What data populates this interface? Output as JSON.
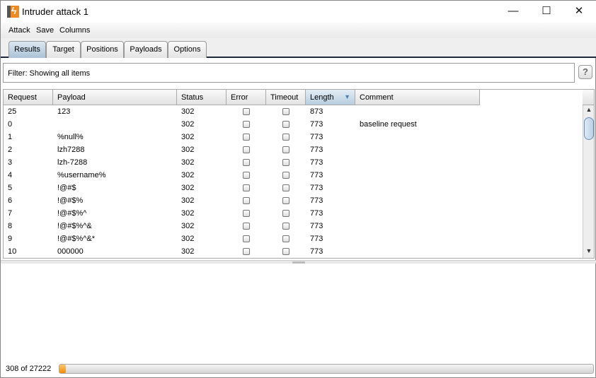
{
  "window": {
    "title": "Intruder attack 1",
    "minimize": "—",
    "maximize": "☐",
    "close": "✕"
  },
  "menu": [
    "Attack",
    "Save",
    "Columns"
  ],
  "tabs": [
    {
      "label": "Results",
      "active": true
    },
    {
      "label": "Target"
    },
    {
      "label": "Positions"
    },
    {
      "label": "Payloads"
    },
    {
      "label": "Options"
    }
  ],
  "filter": {
    "text": "Filter:  Showing all items",
    "help": "?"
  },
  "table": {
    "columns": [
      "Request",
      "Payload",
      "Status",
      "Error",
      "Timeout",
      "Length",
      "Comment"
    ],
    "sorted_column": "Length",
    "sort_direction": "descending",
    "rows": [
      {
        "request": "25",
        "payload": "123",
        "status": "302",
        "error": false,
        "timeout": false,
        "length": "873",
        "comment": ""
      },
      {
        "request": "0",
        "payload": "",
        "status": "302",
        "error": false,
        "timeout": false,
        "length": "773",
        "comment": "baseline request"
      },
      {
        "request": "1",
        "payload": "%null%",
        "status": "302",
        "error": false,
        "timeout": false,
        "length": "773",
        "comment": ""
      },
      {
        "request": "2",
        "payload": "lzh7288",
        "status": "302",
        "error": false,
        "timeout": false,
        "length": "773",
        "comment": ""
      },
      {
        "request": "3",
        "payload": "lzh-7288",
        "status": "302",
        "error": false,
        "timeout": false,
        "length": "773",
        "comment": ""
      },
      {
        "request": "4",
        "payload": "%username%",
        "status": "302",
        "error": false,
        "timeout": false,
        "length": "773",
        "comment": ""
      },
      {
        "request": "5",
        "payload": "!@#$",
        "status": "302",
        "error": false,
        "timeout": false,
        "length": "773",
        "comment": ""
      },
      {
        "request": "6",
        "payload": "!@#$%",
        "status": "302",
        "error": false,
        "timeout": false,
        "length": "773",
        "comment": ""
      },
      {
        "request": "7",
        "payload": "!@#$%^",
        "status": "302",
        "error": false,
        "timeout": false,
        "length": "773",
        "comment": ""
      },
      {
        "request": "8",
        "payload": "!@#$%^&",
        "status": "302",
        "error": false,
        "timeout": false,
        "length": "773",
        "comment": ""
      },
      {
        "request": "9",
        "payload": "!@#$%^&*",
        "status": "302",
        "error": false,
        "timeout": false,
        "length": "773",
        "comment": ""
      },
      {
        "request": "10",
        "payload": "000000",
        "status": "302",
        "error": false,
        "timeout": false,
        "length": "773",
        "comment": ""
      }
    ]
  },
  "progress": {
    "text": "308 of 27222",
    "completed": 308,
    "total": 27222,
    "color": "#f08c00"
  }
}
